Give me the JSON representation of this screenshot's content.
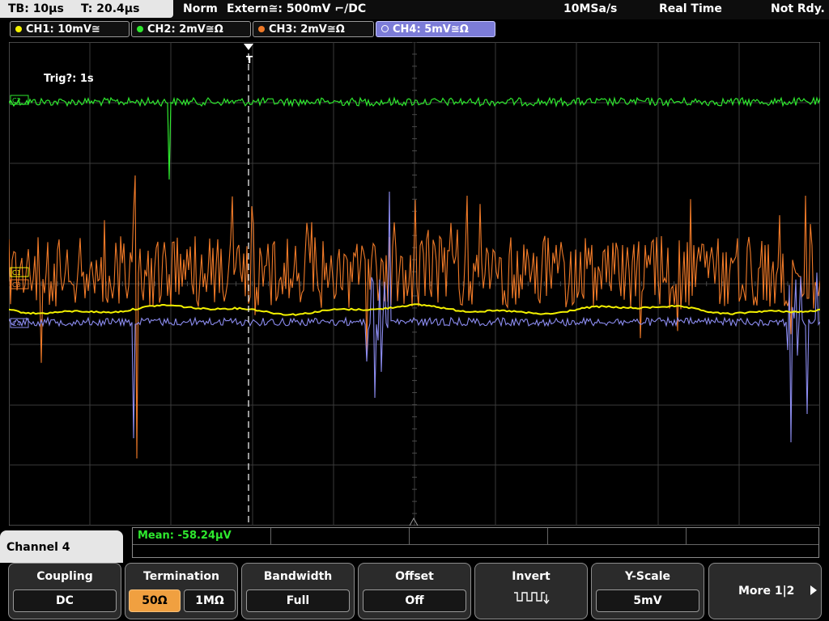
{
  "status": {
    "tb": "TB: 10µs",
    "t": "T: 20.4µs",
    "mode": "Norm",
    "trigger": "Extern≅: 500mV ⌐/DC",
    "sample_rate": "10MSa/s",
    "acq_mode": "Real Time",
    "state": "Not Rdy."
  },
  "channels": [
    {
      "label": "CH1: 10mV≅",
      "color": "#f4f200"
    },
    {
      "label": "CH2: 2mV≅Ω",
      "color": "#2ee82e"
    },
    {
      "label": "CH3: 2mV≅Ω",
      "color": "#f07a28"
    },
    {
      "label": "CH4: 5mV≅Ω",
      "color": "#8c8cf0"
    }
  ],
  "display": {
    "trig_status": "Trig?: 1s",
    "trigger_marker": "T",
    "markers": {
      "c2": "C2",
      "c1": "C1",
      "c3": "C3",
      "c4": "C4"
    }
  },
  "measurement": {
    "mean": "Mean: -58.24µV"
  },
  "menu": {
    "panel_title": "Channel 4",
    "coupling": {
      "label": "Coupling",
      "value": "DC"
    },
    "termination": {
      "label": "Termination",
      "opt1": "50Ω",
      "opt2": "1MΩ"
    },
    "bandwidth": {
      "label": "Bandwidth",
      "value": "Full"
    },
    "offset": {
      "label": "Offset",
      "value": "Off"
    },
    "invert": {
      "label": "Invert"
    },
    "yscale": {
      "label": "Y-Scale",
      "value": "5mV"
    },
    "more": "More 1|2"
  }
}
